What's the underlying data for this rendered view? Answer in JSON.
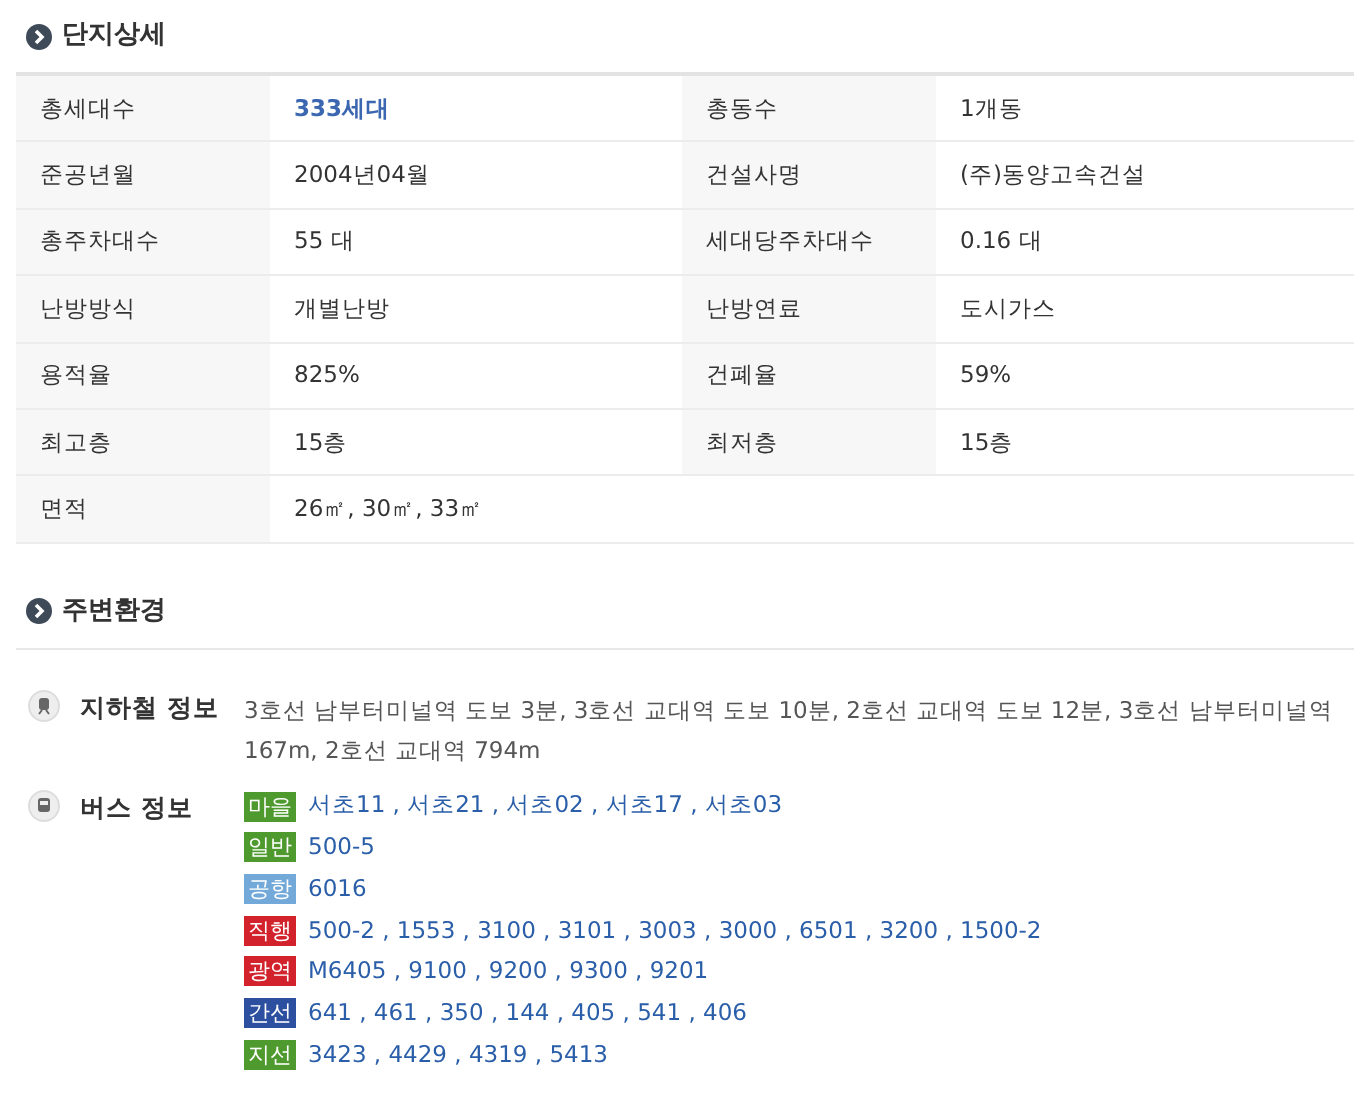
{
  "complex": {
    "title": "단지상세",
    "rows": [
      {
        "cells": [
          {
            "label": "총세대수",
            "value": "333세대",
            "emphasis": true
          },
          {
            "label": "총동수",
            "value": "1개동"
          }
        ]
      },
      {
        "cells": [
          {
            "label": "준공년월",
            "value": "2004년04월"
          },
          {
            "label": "건설사명",
            "value": "(주)동양고속건설"
          }
        ]
      },
      {
        "cells": [
          {
            "label": "총주차대수",
            "value": "55 대"
          },
          {
            "label": "세대당주차대수",
            "value": "0.16 대"
          }
        ]
      },
      {
        "cells": [
          {
            "label": "난방방식",
            "value": "개별난방"
          },
          {
            "label": "난방연료",
            "value": "도시가스"
          }
        ]
      },
      {
        "cells": [
          {
            "label": "용적율",
            "value": "825%"
          },
          {
            "label": "건폐율",
            "value": "59%"
          }
        ]
      },
      {
        "cells": [
          {
            "label": "최고층",
            "value": "15층"
          },
          {
            "label": "최저층",
            "value": "15층"
          }
        ]
      },
      {
        "cells": [
          {
            "label": "면적",
            "value": "26㎡, 30㎡, 33㎡"
          }
        ]
      }
    ]
  },
  "surroundings": {
    "title": "주변환경",
    "subway": {
      "label": "지하철 정보",
      "text": "3호선 남부터미널역 도보 3분, 3호선 교대역 도보 10분, 2호선 교대역 도보 12분, 3호선 남부터미널역 167m, 2호선 교대역 794m"
    },
    "bus": {
      "label": "버스 정보",
      "routes": [
        {
          "type": "마을",
          "color": "#4f9a2f",
          "routes": "서초11 , 서초21 , 서초02 , 서초17 , 서초03"
        },
        {
          "type": "일반",
          "color": "#4f9a2f",
          "routes": "500-5"
        },
        {
          "type": "공항",
          "color": "#72a9d8",
          "routes": "6016"
        },
        {
          "type": "직행",
          "color": "#d2222c",
          "routes": "500-2 , 1553 , 3100 , 3101 , 3003 , 3000 , 6501 , 3200 , 1500-2"
        },
        {
          "type": "광역",
          "color": "#d2222c",
          "routes": "M6405 , 9100 , 9200 , 9300 , 9201"
        },
        {
          "type": "간선",
          "color": "#2c4fa0",
          "routes": "641 , 461 , 350 , 144 , 405 , 541 , 406"
        },
        {
          "type": "지선",
          "color": "#4f9a2f",
          "routes": "3423 , 4429 , 4319 , 5413"
        }
      ]
    }
  }
}
